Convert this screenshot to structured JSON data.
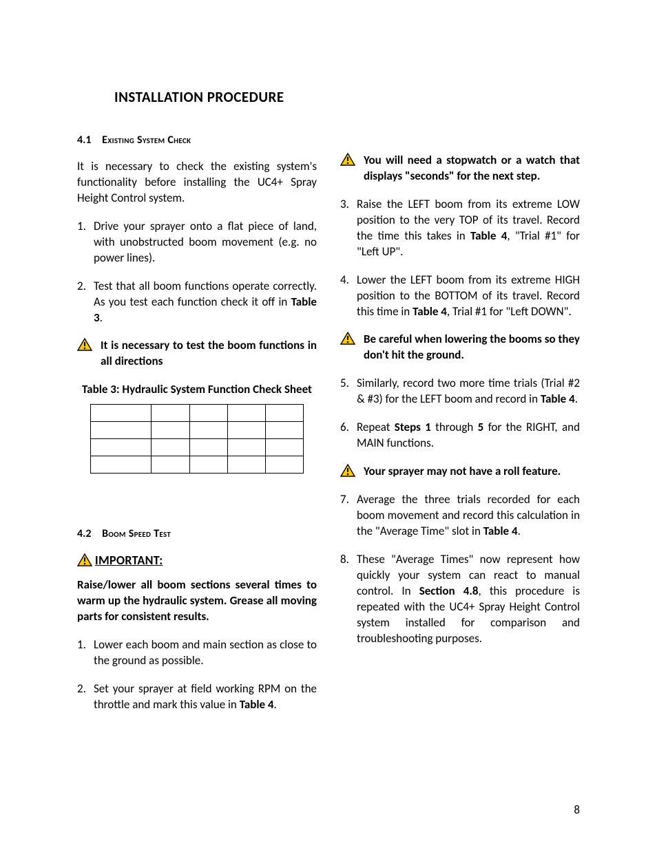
{
  "title": "INSTALLATION PROCEDURE",
  "page_number": "8",
  "sec41": {
    "num": "4.1",
    "title": "Existing System Check"
  },
  "sec42": {
    "num": "4.2",
    "title": "Boom Speed Test"
  },
  "p_intro": "It is necessary to check the existing system's functionality before installing the UC4+ Spray Height Control system.",
  "li1": "Drive your sprayer onto a flat piece of land, with unobstructed boom movement (e.g. no power lines).",
  "li2a": "Test that all boom functions operate correctly.  As you test each function check it off in ",
  "li2b": "Table 3",
  "li2c": ".",
  "note1": "It is necessary to test the boom functions in all directions",
  "table3_caption": "Table 3: Hydraulic System Function Check Sheet",
  "important_label": "IMPORTANT:",
  "important_text": "Raise/lower all boom sections several times to warm up the hydraulic system.  Grease all moving parts for consistent results.",
  "li_b1": "Lower each boom and main section as close to the ground as possible.",
  "li_b2a": "Set your sprayer at field working RPM on the throttle and mark this value in ",
  "li_b2b": "Table 4",
  "li_b2c": ".",
  "note2": "You will need a stopwatch or a watch that displays \"seconds\" for the next step.",
  "li_b3a": "Raise the LEFT boom from its extreme LOW position to the very TOP of its travel.  Record the time this takes in ",
  "li_b3b": "Table 4",
  "li_b3c": ", \"Trial #1\" for \"Left UP\".",
  "li_b4a": "Lower the LEFT boom from its extreme HIGH position to the BOTTOM of its travel.  Record this time in ",
  "li_b4b": "Table 4",
  "li_b4c": ", Trial #1 for \"Left DOWN\".",
  "note3": "Be careful when lowering the booms so they don't hit the ground.",
  "li_b5a": "Similarly, record two more time trials (Trial #2 & #3) for the LEFT boom and record in ",
  "li_b5b": "Table 4",
  "li_b5c": ".",
  "li_b6a": "Repeat ",
  "li_b6b": "Steps 1",
  "li_b6c": " through ",
  "li_b6d": "5",
  "li_b6e": " for the RIGHT, and MAIN functions.",
  "note4": "Your sprayer may not have a roll feature.",
  "li_b7a": "Average the three trials recorded for each boom movement and record this calculation in the \"Average Time\" slot in ",
  "li_b7b": "Table 4",
  "li_b7c": ".",
  "li_b8a": "These \"Average Times\" now represent how quickly your system can react to manual control.  In ",
  "li_b8b": "Section 4.8",
  "li_b8c": ", this procedure is repeated with the UC4+ Spray Height Control system installed for comparison and troubleshooting purposes.",
  "m": {
    "n1": "1.",
    "n2": "2.",
    "n3": "3.",
    "n4": "4.",
    "n5": "5.",
    "n6": "6.",
    "n7": "7.",
    "n8": "8."
  }
}
